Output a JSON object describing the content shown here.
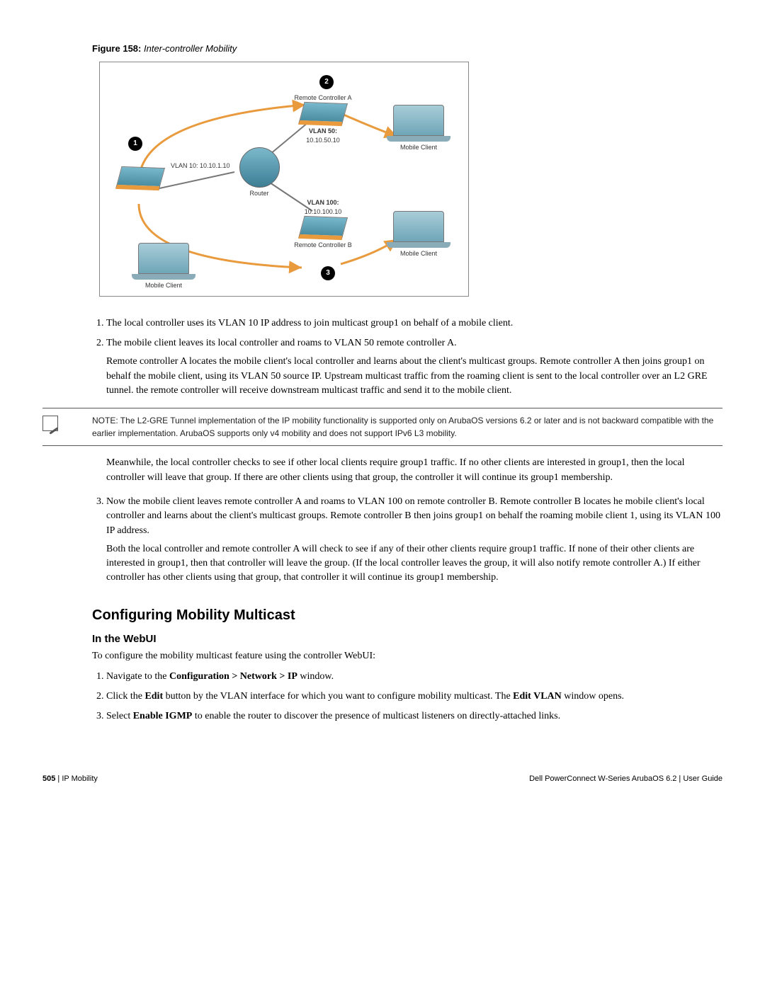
{
  "figure": {
    "label": "Figure 158:",
    "title": "Inter-controller Mobility",
    "labels": {
      "remote_a": "Remote Controller A",
      "remote_b": "Remote Controller B",
      "vlan50_a": "VLAN 50:",
      "vlan50_b": "10.10.50.10",
      "vlan10": "VLAN 10: 10.10.1.10",
      "vlan100_a": "VLAN 100:",
      "vlan100_b": "10.10.100.10",
      "router": "Router",
      "mobile_client": "Mobile Client"
    },
    "bubbles": {
      "b1": "1",
      "b2": "2",
      "b3": "3"
    }
  },
  "steps1": {
    "s1": "The local controller uses its VLAN 10 IP address to join multicast group1 on behalf of a mobile client.",
    "s2": "The mobile client leaves its local controller and roams to VLAN 50 remote controller A.",
    "s2b": "Remote controller A locates the mobile client's local controller and learns about the client's multicast groups. Remote controller A then joins group1 on behalf the mobile client, using its VLAN 50 source IP. Upstream multicast traffic from the roaming client is sent to the local controller over an L2 GRE tunnel. the remote controller will receive downstream multicast traffic and send it to the mobile client."
  },
  "note": "NOTE: The L2-GRE Tunnel implementation of the IP mobility functionality is supported only on ArubaOS versions 6.2 or later and is not backward compatible with the earlier implementation. ArubaOS supports only v4 mobility and does not support IPv6 L3 mobility.",
  "meanwhile": "Meanwhile, the local controller checks to see if other local clients require group1 traffic. If no other clients are interested in group1, then the local controller will leave that group. If there are other clients using that group, the controller it will continue its group1 membership.",
  "steps2": {
    "s3": "Now the mobile client leaves remote controller A and roams to VLAN 100 on remote controller B. Remote controller B locates he mobile client's local controller and learns about the client's multicast groups. Remote controller B then joins group1 on behalf the roaming mobile client 1, using its VLAN 100 IP address.",
    "s3b": "Both the local controller and remote controller A will check to see if any of their other clients require group1 traffic. If none of their other clients are interested in group1, then that controller will leave the group. (If the local controller leaves the group, it will also notify remote controller A.) If either controller has other clients using that group, that controller it will continue its group1 membership."
  },
  "section": "Configuring Mobility Multicast",
  "subsec": "In the WebUI",
  "lead": "To configure the mobility multicast feature using the controller WebUI:",
  "webui": {
    "s1_a": "Navigate to the ",
    "s1_b": "Configuration > Network > IP",
    "s1_c": " window.",
    "s2_a": "Click the ",
    "s2_b": "Edit",
    "s2_c": " button by the VLAN interface for which you want to configure mobility multicast. The ",
    "s2_d": "Edit VLAN",
    "s2_e": " window opens.",
    "s3_a": "Select ",
    "s3_b": "Enable IGMP",
    "s3_c": " to enable the router to discover the presence of multicast listeners on directly-attached links."
  },
  "footer": {
    "page": "505",
    "section": "IP Mobility",
    "sep": " | ",
    "prod": "Dell PowerConnect W-Series ArubaOS 6.2",
    "guide": "User Guide"
  }
}
